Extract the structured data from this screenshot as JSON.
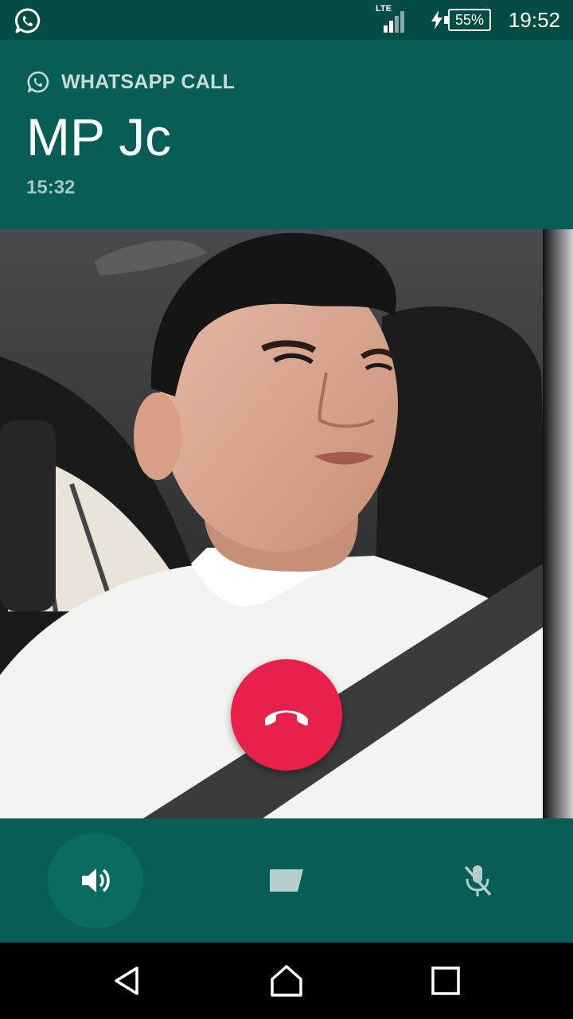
{
  "status_bar": {
    "network_type": "LTE",
    "battery_percent": "55%",
    "clock": "19:52",
    "app_icon": "whatsapp-icon",
    "signal_level": 0.6
  },
  "call": {
    "label": "WHATSAPP CALL",
    "contact_name": "MP Jc",
    "duration": "15:32"
  },
  "controls": {
    "speaker": {
      "icon": "speaker-icon",
      "active": true
    },
    "video": {
      "icon": "video-camera-icon",
      "active": false
    },
    "mute": {
      "icon": "mic-off-icon",
      "active": false
    },
    "end_call": {
      "icon": "end-call-icon"
    }
  },
  "nav_bar": {
    "items": [
      {
        "icon": "back-icon"
      },
      {
        "icon": "home-icon"
      },
      {
        "icon": "recents-icon"
      }
    ]
  },
  "colors": {
    "header": "#075e54",
    "status_bar": "#054d44",
    "end_call": "#e8214b",
    "active_button": "#0a6c60"
  }
}
